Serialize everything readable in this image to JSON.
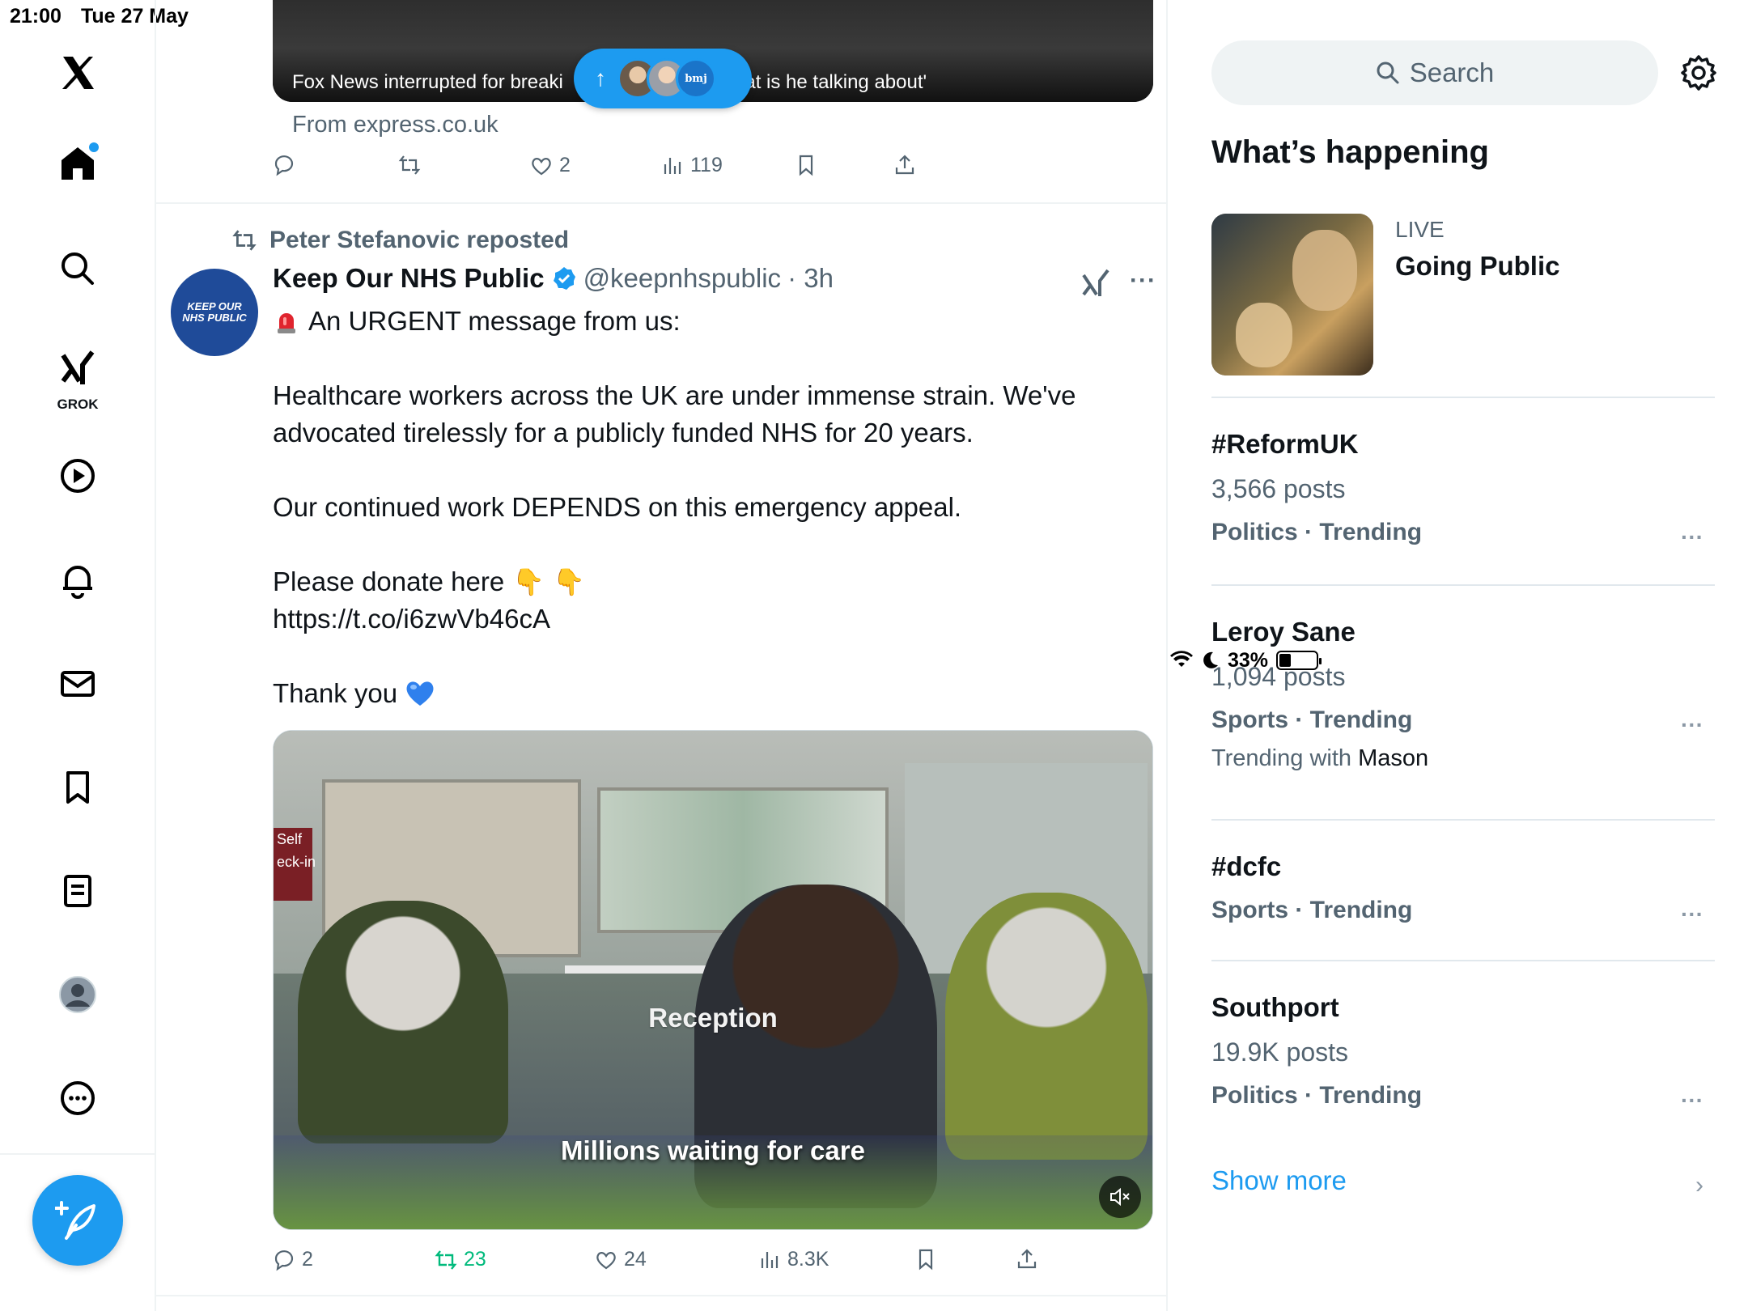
{
  "status_bar": {
    "time": "21:00",
    "date": "Tue 27 May",
    "battery": "33%"
  },
  "nav": {
    "grok_label": "GROK"
  },
  "previous_post": {
    "caption_left": "Fox News interrupted for breaki",
    "caption_right": "hat is he talking about'",
    "from": "From express.co.uk",
    "likes": "2",
    "views": "119"
  },
  "new_posts_pill": {
    "avatar3_text": "bmj"
  },
  "post": {
    "reposted_by": "Peter Stefanovic reposted",
    "avatar_text_1": "KEEP OUR",
    "avatar_text_2": "NHS PUBLIC",
    "name": "Keep Our NHS Public",
    "handle": "@keepnhspublic",
    "time": "· 3h",
    "line1": "An URGENT message from us:",
    "para1": "Healthcare workers across the UK are under immense strain. We've advocated tirelessly for a publicly funded NHS for 20 years.",
    "para2": "Our continued work DEPENDS on this emergency appeal.",
    "donate": "Please donate here",
    "link": "https://t.co/i6zwVb46cA",
    "thanks": "Thank you",
    "video_sign": "Self\neck-in",
    "video_caption_top": "Reception",
    "video_caption_bottom": "Millions waiting for care",
    "replies": "2",
    "reposts": "23",
    "likes": "24",
    "views": "8.3K"
  },
  "sidebar": {
    "search_placeholder": "Search",
    "whats_happening": "What’s happening",
    "live": {
      "label": "LIVE",
      "title": "Going Public"
    },
    "trends": [
      {
        "title": "#ReformUK",
        "posts": "3,566 posts",
        "category": "Politics · Trending"
      },
      {
        "title": "Leroy Sane",
        "posts": "1,094 posts",
        "category": "Sports · Trending",
        "with_prefix": "Trending with",
        "with_name": "Mason"
      },
      {
        "title": "#dcfc",
        "category": "Sports · Trending"
      },
      {
        "title": "Southport",
        "posts": "19.9K posts",
        "category": "Politics · Trending"
      }
    ],
    "show_more": "Show more"
  },
  "colors": {
    "accent": "#1d9bf0",
    "text": "#0f1419",
    "muted": "#536471",
    "repost_green": "#00ba7c"
  },
  "icons": [
    "x-logo-icon",
    "home-icon",
    "search-icon",
    "grok-icon",
    "video-icon",
    "bell-icon",
    "mail-icon",
    "bookmark-icon",
    "list-icon",
    "profile-icon",
    "more-icon",
    "compose-icon",
    "reply-icon",
    "repost-icon",
    "heart-icon",
    "views-icon",
    "share-icon",
    "verified-icon",
    "settings-icon",
    "mute-icon",
    "chevron-right-icon"
  ]
}
